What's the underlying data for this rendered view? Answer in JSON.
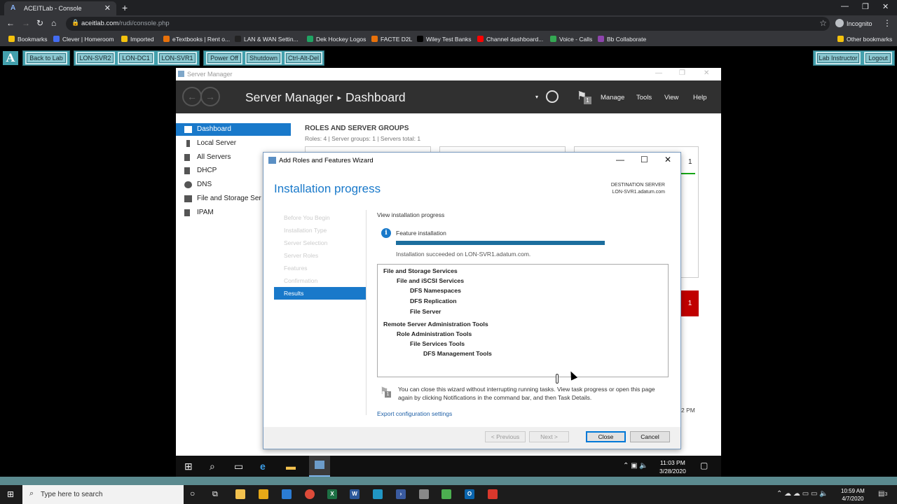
{
  "browser": {
    "tab_title": "ACEITLab - Console",
    "favicon_letter": "A",
    "url_domain": "aceitlab.com",
    "url_path": "/rudi/console.php",
    "incognito_label": "Incognito"
  },
  "bookmarks": [
    {
      "label": "Bookmarks",
      "icon": "folder-icon",
      "color": "#f4c20d"
    },
    {
      "label": "Clever | Homeroom",
      "icon": "clever-icon",
      "color": "#436cf2"
    },
    {
      "label": "Imported",
      "icon": "folder-icon",
      "color": "#f4c20d"
    },
    {
      "label": "eTextbooks | Rent o...",
      "icon": "etextbooks-icon",
      "color": "#e8710a"
    },
    {
      "label": "LAN & WAN Settin...",
      "icon": "x-icon",
      "color": "#222222"
    },
    {
      "label": "Dek Hockey Logos",
      "icon": "drive-icon",
      "color": "#1fa463"
    },
    {
      "label": "FACTE D2L",
      "icon": "d2l-icon",
      "color": "#e8710a"
    },
    {
      "label": "Wiley Test Banks",
      "icon": "wiley-icon",
      "color": "#000000"
    },
    {
      "label": "Channel dashboard...",
      "icon": "youtube-icon",
      "color": "#ff0000"
    },
    {
      "label": "Voice - Calls",
      "icon": "voice-icon",
      "color": "#34a853"
    },
    {
      "label": "Bb Collaborate",
      "icon": "collaborate-icon",
      "color": "#8e44ad"
    }
  ],
  "other_bookmarks": "Other bookmarks",
  "lab_toolbar": {
    "logo": "A",
    "back_to_lab": "Back to Lab",
    "machines": [
      "LON-SVR2",
      "LON-DC1",
      "LON-SVR1"
    ],
    "power_off": "Power Off",
    "shutdown": "Shutdown",
    "ctrl_alt_del": "Ctrl-Alt-Del",
    "lab_instructor": "Lab Instructor",
    "logout": "Logout"
  },
  "server_manager": {
    "window_title": "Server Manager",
    "crumb_root": "Server Manager",
    "crumb_sep": "▸",
    "crumb_page": "Dashboard",
    "menu": [
      "Manage",
      "Tools",
      "View",
      "Help"
    ],
    "notification_count": "1",
    "sidebar": [
      "Dashboard",
      "Local Server",
      "All Servers",
      "DHCP",
      "DNS",
      "File and Storage Ser",
      "IPAM"
    ],
    "section_title": "ROLES AND SERVER GROUPS",
    "section_sub": "Roles: 4   |   Server groups: 1   |   Servers total: 1",
    "tile_count": "1",
    "red_tile_count": "1",
    "pm_text": "2 PM"
  },
  "wizard": {
    "title": "Add Roles and Features Wizard",
    "heading": "Installation progress",
    "dest_label": "DESTINATION SERVER",
    "dest_server": "LON-SVR1.adatum.com",
    "steps": [
      "Before You Begin",
      "Installation Type",
      "Server Selection",
      "Server Roles",
      "Features",
      "Confirmation",
      "Results"
    ],
    "active_step": "Results",
    "view_progress": "View installation progress",
    "feature_label": "Feature installation",
    "progress": 1.0,
    "success_text": "Installation succeeded on LON-SVR1.adatum.com.",
    "results": [
      {
        "text": "File and Storage Services",
        "level": 0
      },
      {
        "text": "File and iSCSI Services",
        "level": 1
      },
      {
        "text": "DFS Namespaces",
        "level": 2
      },
      {
        "text": "DFS Replication",
        "level": 2
      },
      {
        "text": "File Server",
        "level": 2
      },
      {
        "text": "Remote Server Administration Tools",
        "level": 0
      },
      {
        "text": "Role Administration Tools",
        "level": 1
      },
      {
        "text": "File Services Tools",
        "level": 2
      },
      {
        "text": "DFS Management Tools",
        "level": 3
      }
    ],
    "note": "You can close this wizard without interrupting running tasks. View task progress or open this page again by clicking Notifications in the command bar, and then Task Details.",
    "export_link": "Export configuration settings",
    "buttons": {
      "previous": "< Previous",
      "next": "Next >",
      "close": "Close",
      "cancel": "Cancel"
    }
  },
  "vm_taskbar": {
    "time": "11:03 PM",
    "date": "3/28/2020"
  },
  "host_taskbar": {
    "search_placeholder": "Type here to search",
    "time": "10:59 AM",
    "date": "4/7/2020",
    "notification_count": "3"
  }
}
